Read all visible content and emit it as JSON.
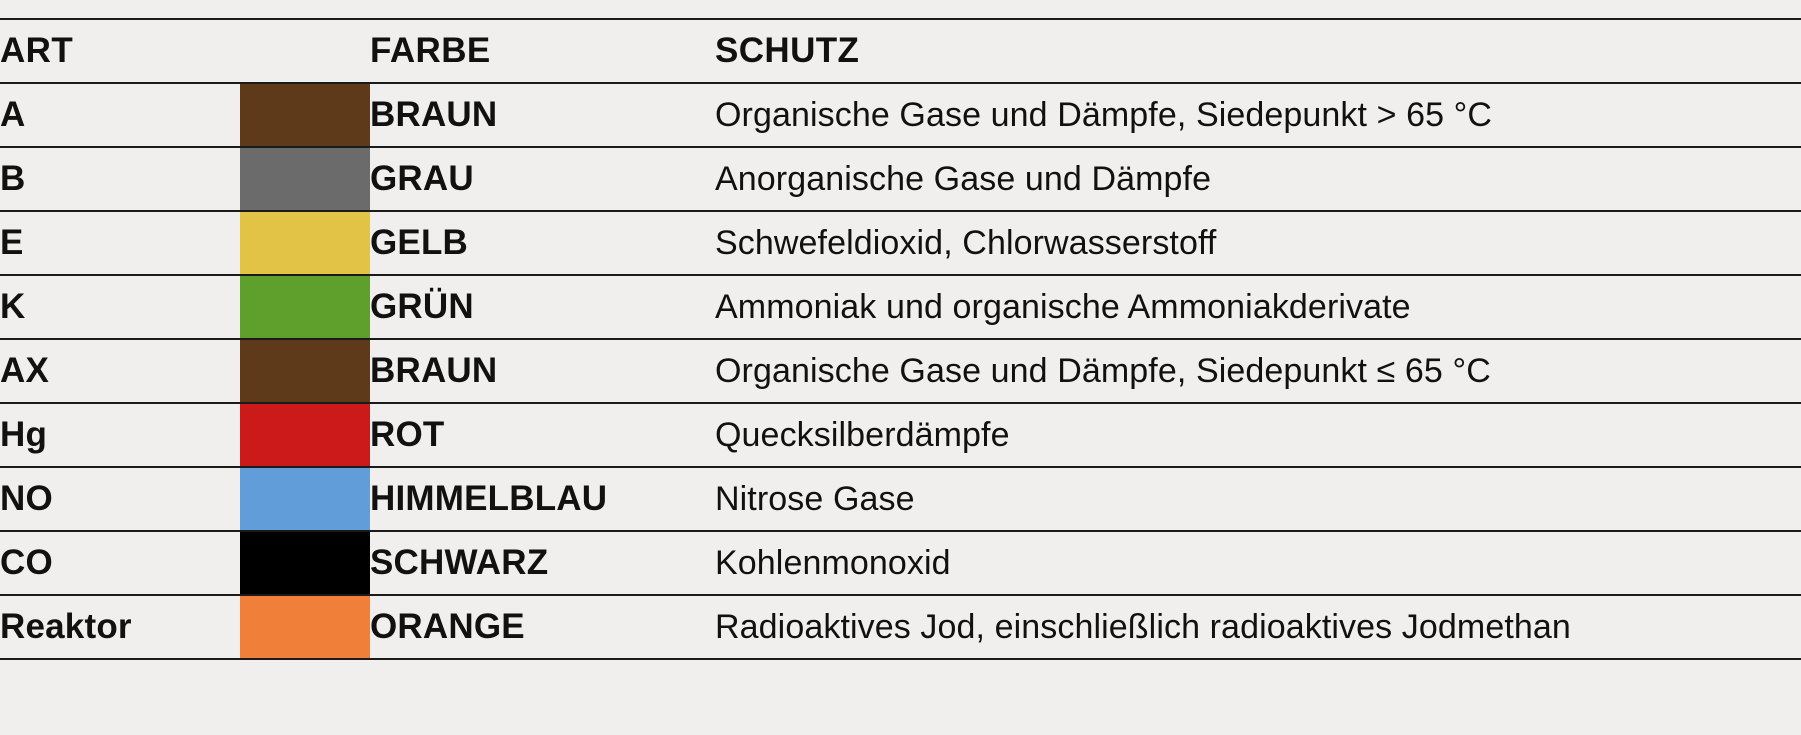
{
  "table": {
    "headers": {
      "art": "ART",
      "farbe": "FARBE",
      "schutz": "SCHUTZ"
    },
    "rows": [
      {
        "art": "A",
        "swatch_hex": "#5E3A1B",
        "farbe": "BRAUN",
        "schutz": "Organische Gase und Dämpfe, Siedepunkt > 65 °C"
      },
      {
        "art": "B",
        "swatch_hex": "#6B6B6B",
        "farbe": "GRAU",
        "schutz": "Anorganische Gase und Dämpfe"
      },
      {
        "art": "E",
        "swatch_hex": "#E3C346",
        "farbe": "GELB",
        "schutz": "Schwefeldioxid, Chlorwasserstoff"
      },
      {
        "art": "K",
        "swatch_hex": "#5FA02C",
        "farbe": "GRÜN",
        "schutz": "Ammoniak und organische Ammoniakderivate"
      },
      {
        "art": "AX",
        "swatch_hex": "#5E3A1B",
        "farbe": "BRAUN",
        "schutz": "Organische Gase und Dämpfe, Siedepunkt ≤ 65 °C"
      },
      {
        "art": "Hg",
        "swatch_hex": "#CC1A1A",
        "farbe": "ROT",
        "schutz": "Quecksilberdämpfe"
      },
      {
        "art": "NO",
        "swatch_hex": "#619ED9",
        "farbe": "HIMMELBLAU",
        "schutz": "Nitrose Gase"
      },
      {
        "art": "CO",
        "swatch_hex": "#000000",
        "farbe": "SCHWARZ",
        "schutz": "Kohlenmonoxid"
      },
      {
        "art": "Reaktor",
        "swatch_hex": "#F08039",
        "farbe": "ORANGE",
        "schutz": "Radioaktives Jod, einschließlich radioaktives Jodmethan"
      }
    ]
  },
  "theme": {
    "background_hex": "#F0EFEE",
    "rule_hex": "#1A1A1A",
    "text_hex": "#111111"
  }
}
